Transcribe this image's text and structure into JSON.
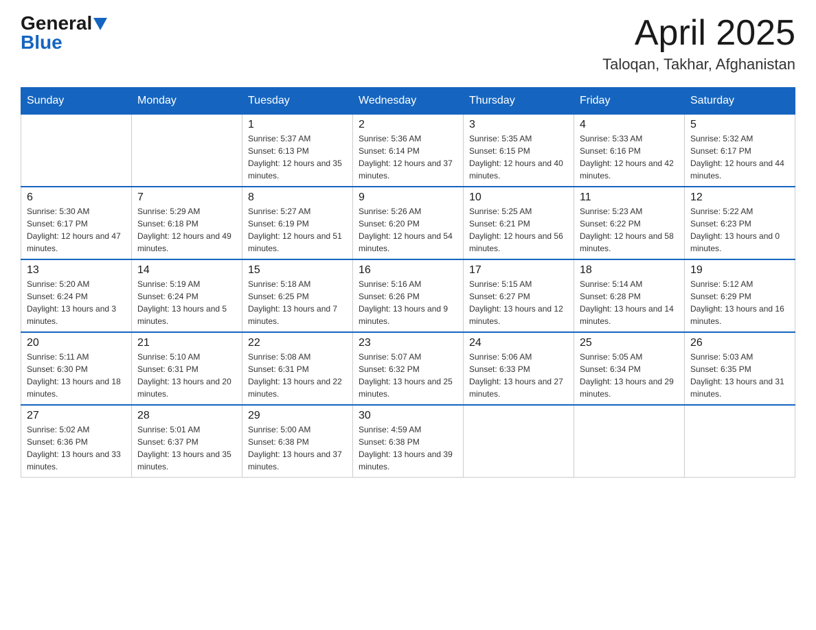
{
  "logo": {
    "general": "General",
    "blue": "Blue",
    "triangle": "▲"
  },
  "title": {
    "month_year": "April 2025",
    "location": "Taloqan, Takhar, Afghanistan"
  },
  "headers": [
    "Sunday",
    "Monday",
    "Tuesday",
    "Wednesday",
    "Thursday",
    "Friday",
    "Saturday"
  ],
  "weeks": [
    [
      {
        "day": "",
        "sunrise": "",
        "sunset": "",
        "daylight": ""
      },
      {
        "day": "",
        "sunrise": "",
        "sunset": "",
        "daylight": ""
      },
      {
        "day": "1",
        "sunrise": "Sunrise: 5:37 AM",
        "sunset": "Sunset: 6:13 PM",
        "daylight": "Daylight: 12 hours and 35 minutes."
      },
      {
        "day": "2",
        "sunrise": "Sunrise: 5:36 AM",
        "sunset": "Sunset: 6:14 PM",
        "daylight": "Daylight: 12 hours and 37 minutes."
      },
      {
        "day": "3",
        "sunrise": "Sunrise: 5:35 AM",
        "sunset": "Sunset: 6:15 PM",
        "daylight": "Daylight: 12 hours and 40 minutes."
      },
      {
        "day": "4",
        "sunrise": "Sunrise: 5:33 AM",
        "sunset": "Sunset: 6:16 PM",
        "daylight": "Daylight: 12 hours and 42 minutes."
      },
      {
        "day": "5",
        "sunrise": "Sunrise: 5:32 AM",
        "sunset": "Sunset: 6:17 PM",
        "daylight": "Daylight: 12 hours and 44 minutes."
      }
    ],
    [
      {
        "day": "6",
        "sunrise": "Sunrise: 5:30 AM",
        "sunset": "Sunset: 6:17 PM",
        "daylight": "Daylight: 12 hours and 47 minutes."
      },
      {
        "day": "7",
        "sunrise": "Sunrise: 5:29 AM",
        "sunset": "Sunset: 6:18 PM",
        "daylight": "Daylight: 12 hours and 49 minutes."
      },
      {
        "day": "8",
        "sunrise": "Sunrise: 5:27 AM",
        "sunset": "Sunset: 6:19 PM",
        "daylight": "Daylight: 12 hours and 51 minutes."
      },
      {
        "day": "9",
        "sunrise": "Sunrise: 5:26 AM",
        "sunset": "Sunset: 6:20 PM",
        "daylight": "Daylight: 12 hours and 54 minutes."
      },
      {
        "day": "10",
        "sunrise": "Sunrise: 5:25 AM",
        "sunset": "Sunset: 6:21 PM",
        "daylight": "Daylight: 12 hours and 56 minutes."
      },
      {
        "day": "11",
        "sunrise": "Sunrise: 5:23 AM",
        "sunset": "Sunset: 6:22 PM",
        "daylight": "Daylight: 12 hours and 58 minutes."
      },
      {
        "day": "12",
        "sunrise": "Sunrise: 5:22 AM",
        "sunset": "Sunset: 6:23 PM",
        "daylight": "Daylight: 13 hours and 0 minutes."
      }
    ],
    [
      {
        "day": "13",
        "sunrise": "Sunrise: 5:20 AM",
        "sunset": "Sunset: 6:24 PM",
        "daylight": "Daylight: 13 hours and 3 minutes."
      },
      {
        "day": "14",
        "sunrise": "Sunrise: 5:19 AM",
        "sunset": "Sunset: 6:24 PM",
        "daylight": "Daylight: 13 hours and 5 minutes."
      },
      {
        "day": "15",
        "sunrise": "Sunrise: 5:18 AM",
        "sunset": "Sunset: 6:25 PM",
        "daylight": "Daylight: 13 hours and 7 minutes."
      },
      {
        "day": "16",
        "sunrise": "Sunrise: 5:16 AM",
        "sunset": "Sunset: 6:26 PM",
        "daylight": "Daylight: 13 hours and 9 minutes."
      },
      {
        "day": "17",
        "sunrise": "Sunrise: 5:15 AM",
        "sunset": "Sunset: 6:27 PM",
        "daylight": "Daylight: 13 hours and 12 minutes."
      },
      {
        "day": "18",
        "sunrise": "Sunrise: 5:14 AM",
        "sunset": "Sunset: 6:28 PM",
        "daylight": "Daylight: 13 hours and 14 minutes."
      },
      {
        "day": "19",
        "sunrise": "Sunrise: 5:12 AM",
        "sunset": "Sunset: 6:29 PM",
        "daylight": "Daylight: 13 hours and 16 minutes."
      }
    ],
    [
      {
        "day": "20",
        "sunrise": "Sunrise: 5:11 AM",
        "sunset": "Sunset: 6:30 PM",
        "daylight": "Daylight: 13 hours and 18 minutes."
      },
      {
        "day": "21",
        "sunrise": "Sunrise: 5:10 AM",
        "sunset": "Sunset: 6:31 PM",
        "daylight": "Daylight: 13 hours and 20 minutes."
      },
      {
        "day": "22",
        "sunrise": "Sunrise: 5:08 AM",
        "sunset": "Sunset: 6:31 PM",
        "daylight": "Daylight: 13 hours and 22 minutes."
      },
      {
        "day": "23",
        "sunrise": "Sunrise: 5:07 AM",
        "sunset": "Sunset: 6:32 PM",
        "daylight": "Daylight: 13 hours and 25 minutes."
      },
      {
        "day": "24",
        "sunrise": "Sunrise: 5:06 AM",
        "sunset": "Sunset: 6:33 PM",
        "daylight": "Daylight: 13 hours and 27 minutes."
      },
      {
        "day": "25",
        "sunrise": "Sunrise: 5:05 AM",
        "sunset": "Sunset: 6:34 PM",
        "daylight": "Daylight: 13 hours and 29 minutes."
      },
      {
        "day": "26",
        "sunrise": "Sunrise: 5:03 AM",
        "sunset": "Sunset: 6:35 PM",
        "daylight": "Daylight: 13 hours and 31 minutes."
      }
    ],
    [
      {
        "day": "27",
        "sunrise": "Sunrise: 5:02 AM",
        "sunset": "Sunset: 6:36 PM",
        "daylight": "Daylight: 13 hours and 33 minutes."
      },
      {
        "day": "28",
        "sunrise": "Sunrise: 5:01 AM",
        "sunset": "Sunset: 6:37 PM",
        "daylight": "Daylight: 13 hours and 35 minutes."
      },
      {
        "day": "29",
        "sunrise": "Sunrise: 5:00 AM",
        "sunset": "Sunset: 6:38 PM",
        "daylight": "Daylight: 13 hours and 37 minutes."
      },
      {
        "day": "30",
        "sunrise": "Sunrise: 4:59 AM",
        "sunset": "Sunset: 6:38 PM",
        "daylight": "Daylight: 13 hours and 39 minutes."
      },
      {
        "day": "",
        "sunrise": "",
        "sunset": "",
        "daylight": ""
      },
      {
        "day": "",
        "sunrise": "",
        "sunset": "",
        "daylight": ""
      },
      {
        "day": "",
        "sunrise": "",
        "sunset": "",
        "daylight": ""
      }
    ]
  ]
}
